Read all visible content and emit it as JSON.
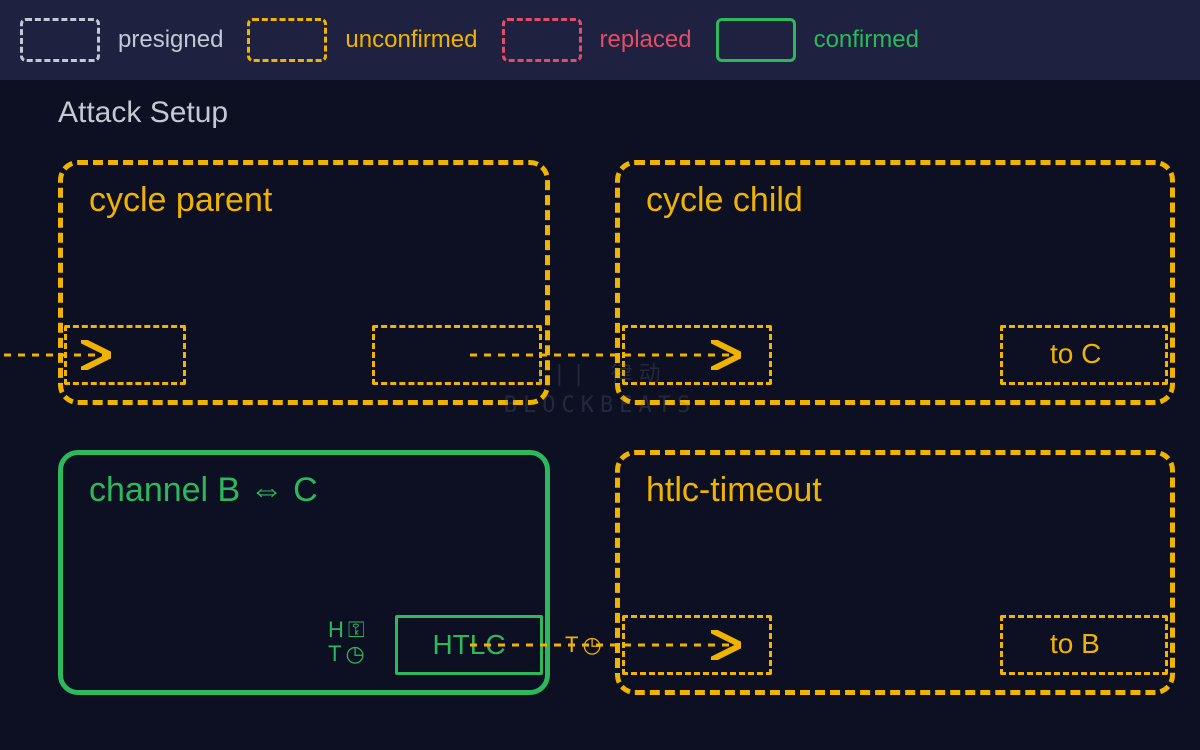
{
  "legend": {
    "presigned": "presigned",
    "unconfirmed": "unconfirmed",
    "replaced": "replaced",
    "confirmed": "confirmed"
  },
  "title": "Attack Setup",
  "boxes": {
    "cycle_parent": "cycle parent",
    "cycle_child": "cycle child",
    "cycle_child_out": "to C",
    "channel_bc": "channel B ⇔ C",
    "htlc_box": "HTLC",
    "htlc_timeout": "htlc-timeout",
    "htlc_timeout_out": "to B"
  },
  "annot": {
    "h_key": "H",
    "t_clock": "T",
    "arrow_t": "T"
  },
  "colors": {
    "bg": "#0d1023",
    "legend_bg": "#1e2140",
    "gray": "#c3c8d4",
    "yellow": "#f0b400",
    "red": "#e34d65",
    "green": "#2db85c"
  },
  "watermark": "律动\nBLOCKBEATS"
}
